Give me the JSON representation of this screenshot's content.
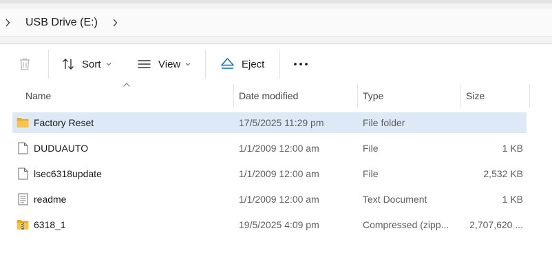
{
  "breadcrumb": {
    "location": "USB Drive (E:)"
  },
  "toolbar": {
    "delete_icon": "trash-icon",
    "sort_label": "Sort",
    "view_label": "View",
    "eject_label": "Eject",
    "more_icon": "more-ellipsis-icon"
  },
  "columns": {
    "name": "Name",
    "date_modified": "Date modified",
    "type": "Type",
    "size": "Size"
  },
  "files": [
    {
      "name": "Factory Reset",
      "date": "17/5/2025 11:29 pm",
      "type": "File folder",
      "size": "",
      "icon": "folder-icon",
      "selected": true
    },
    {
      "name": "DUDUAUTO",
      "date": "1/1/2009 12:00 am",
      "type": "File",
      "size": "1 KB",
      "icon": "file-icon",
      "selected": false
    },
    {
      "name": "lsec6318update",
      "date": "1/1/2009 12:00 am",
      "type": "File",
      "size": "2,532 KB",
      "icon": "file-icon",
      "selected": false
    },
    {
      "name": "readme",
      "date": "1/1/2009 12:00 am",
      "type": "Text Document",
      "size": "1 KB",
      "icon": "text-document-icon",
      "selected": false
    },
    {
      "name": "6318_1",
      "date": "19/5/2025 4:09 pm",
      "type": "Compressed (zipp...",
      "size": "2,707,620 ...",
      "icon": "zip-folder-icon",
      "selected": false
    }
  ],
  "colors": {
    "selection": "#dde9f6",
    "folder": "#f8c548",
    "eject_accent": "#0067c0"
  }
}
